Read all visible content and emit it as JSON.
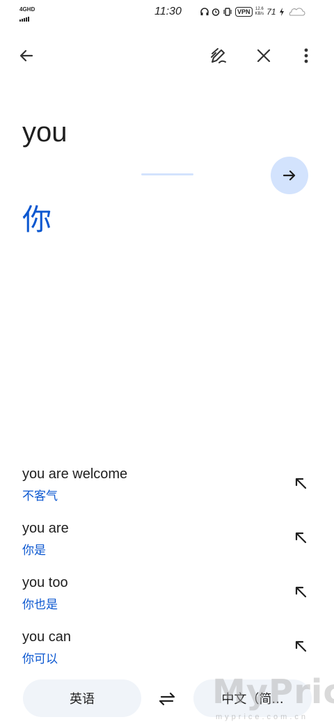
{
  "status_bar": {
    "network": "4GHD",
    "time": "11:30",
    "vpn": "VPN",
    "speed_value": "12.6",
    "speed_unit": "KB/s",
    "battery": "71"
  },
  "toolbar": {
    "icons": [
      "back-arrow-icon",
      "handwriting-icon",
      "close-icon",
      "more-vert-icon"
    ]
  },
  "translation": {
    "source_text": "you",
    "target_text": "你"
  },
  "suggestions": [
    {
      "en": "you are welcome",
      "zh": "不客气"
    },
    {
      "en": "you are",
      "zh": "你是"
    },
    {
      "en": "you too",
      "zh": "你也是"
    },
    {
      "en": "you can",
      "zh": "你可以"
    }
  ],
  "language_bar": {
    "source_lang": "英语",
    "target_lang": "中文（简..."
  },
  "watermark": {
    "text": "MyPrice",
    "sub": "myprice.com.cn"
  },
  "colors": {
    "accent": "#0b57d0",
    "fab_bg": "#d3e3fd",
    "chip_bg": "#f0f4f9"
  }
}
